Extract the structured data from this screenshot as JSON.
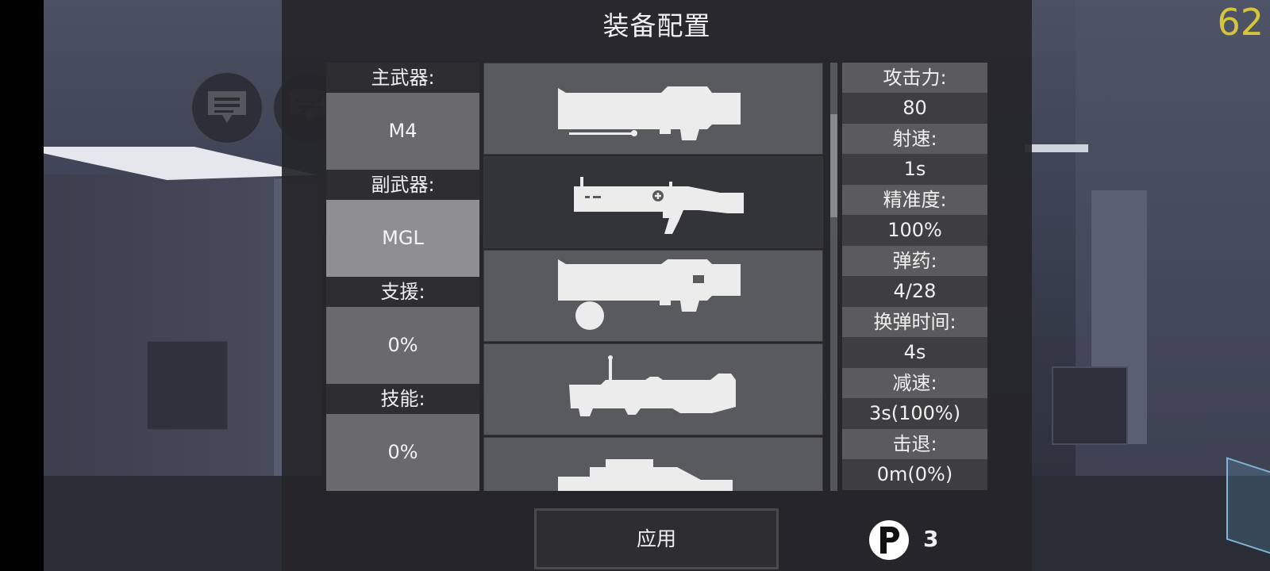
{
  "title": "装备配置",
  "fps": "62",
  "slots": [
    {
      "label": "主武器:",
      "value": "M4",
      "selected": false
    },
    {
      "label": "副武器:",
      "value": "MGL",
      "selected": true
    },
    {
      "label": "支援:",
      "value": "0%",
      "selected": false
    },
    {
      "label": "技能:",
      "value": "0%",
      "selected": false
    }
  ],
  "weapons": [
    {
      "icon": "rocket-launcher-icon"
    },
    {
      "icon": "grenade-launcher-icon"
    },
    {
      "icon": "orb-launcher-icon"
    },
    {
      "icon": "rpg-icon"
    },
    {
      "icon": "heavy-launcher-icon"
    }
  ],
  "stats": [
    {
      "label": "攻击力:",
      "value": "80"
    },
    {
      "label": "射速:",
      "value": "1s"
    },
    {
      "label": "精准度:",
      "value": "100%"
    },
    {
      "label": "弹药:",
      "value": "4/28"
    },
    {
      "label": "换弹时间:",
      "value": "4s"
    },
    {
      "label": "减速:",
      "value": "3s(100%)"
    },
    {
      "label": "击退:",
      "value": "0m(0%)"
    }
  ],
  "apply_label": "应用",
  "points": "3",
  "colors": {
    "fps": "#d6c43a",
    "panel": "#262629",
    "selected_slot": "#8f8f91"
  }
}
